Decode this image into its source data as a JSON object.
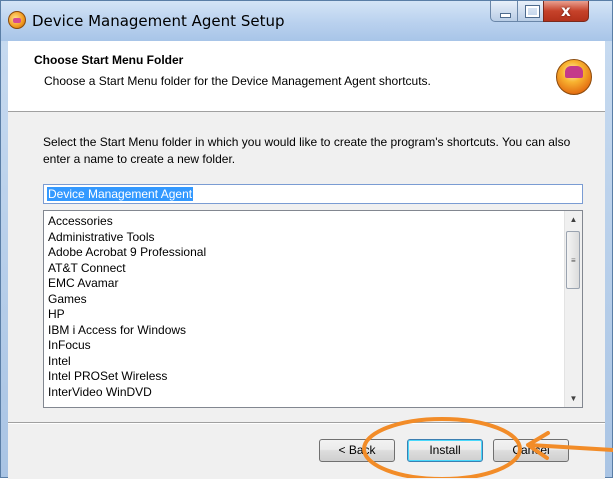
{
  "window": {
    "title": "Device Management Agent Setup",
    "close_glyph": "x",
    "icon": "setup-app-icon"
  },
  "header": {
    "title": "Choose Start Menu Folder",
    "subtitle": "Choose a Start Menu folder for the Device Management Agent shortcuts.",
    "logo_icon": "installer-logo-icon"
  },
  "main": {
    "description": "Select the Start Menu folder in which you would like to create the program's shortcuts. You can also enter a name to create a new folder.",
    "folder_input_value": "Device Management Agent",
    "folder_list": [
      "Accessories",
      "Administrative Tools",
      "Adobe Acrobat 9 Professional",
      "AT&T Connect",
      "EMC Avamar",
      "Games",
      "HP",
      "IBM i Access for Windows",
      "InFocus",
      "Intel",
      "Intel PROSet Wireless",
      "InterVideo WinDVD"
    ],
    "scroll_up_glyph": "▲",
    "scroll_down_glyph": "▼",
    "scroll_grip_glyph": "≡"
  },
  "buttons": {
    "back_label": "< Back",
    "install_label": "Install",
    "cancel_label": "Cancel"
  },
  "annotation": {
    "highlight_color": "#f28c28",
    "shapes": [
      "ellipse-around-install",
      "arrow-pointing-to-install"
    ]
  }
}
